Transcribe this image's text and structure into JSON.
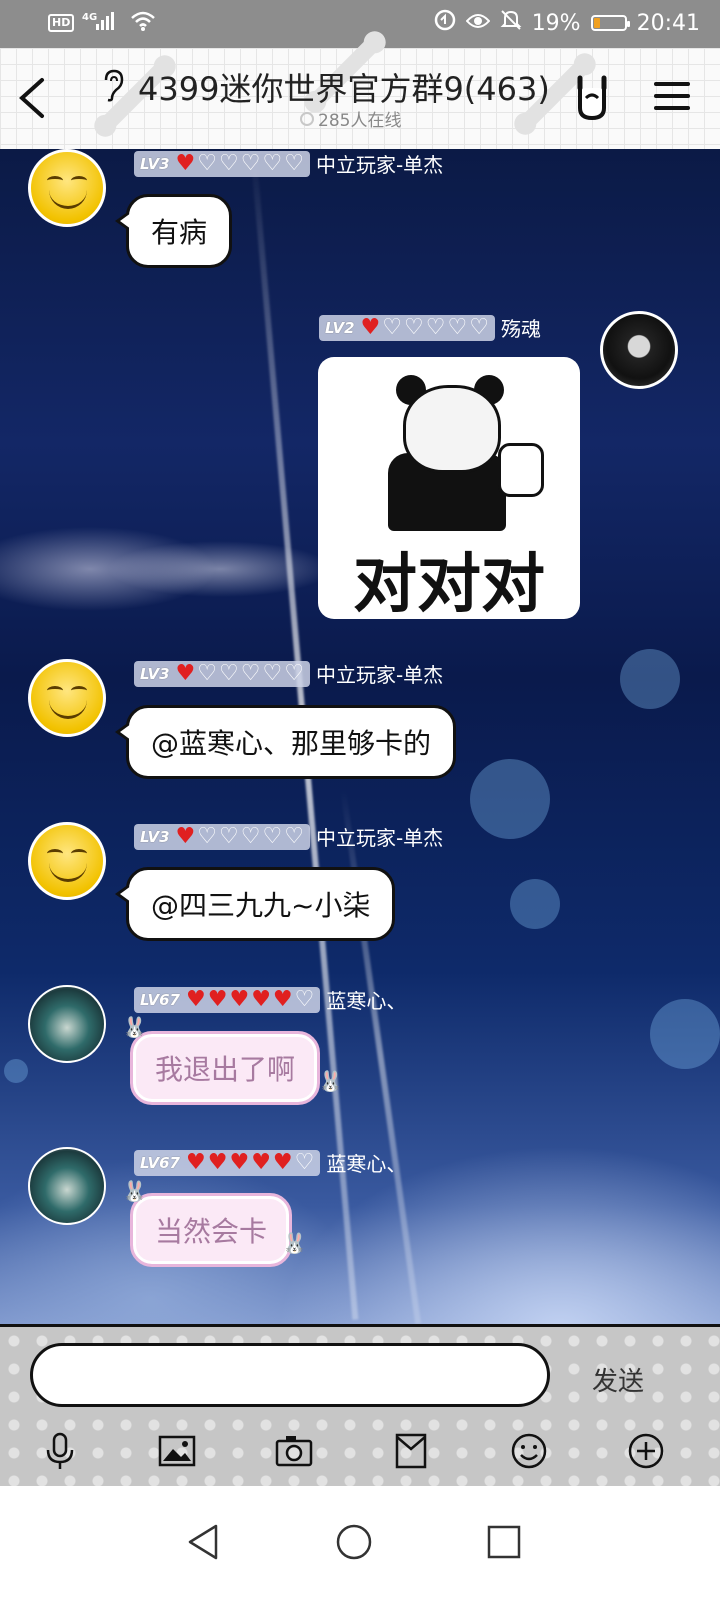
{
  "status_bar": {
    "network": "4G",
    "hd_label": "HD",
    "battery_percent": "19%",
    "battery_level": 0.19,
    "time": "20:41",
    "icons": [
      "hd-icon",
      "signal-icon",
      "wifi-icon",
      "data-saver-icon",
      "eye-icon",
      "mute-icon",
      "battery-icon"
    ]
  },
  "header": {
    "title": "4399迷你世界官方群9(463)",
    "online": "285人在线",
    "icons": [
      "back-icon",
      "ear-icon",
      "rock-hand-icon",
      "menu-icon"
    ]
  },
  "messages": [
    {
      "side": "left",
      "level": "LV3",
      "hearts_filled": 1,
      "hearts_total": 6,
      "nickname": "中立玩家-单杰",
      "type": "text",
      "text": "有病",
      "style": "white"
    },
    {
      "side": "right",
      "level": "LV2",
      "hearts_filled": 1,
      "hearts_total": 6,
      "nickname": "殇魂",
      "type": "sticker",
      "sticker_text": "对对对"
    },
    {
      "side": "left",
      "level": "LV3",
      "hearts_filled": 1,
      "hearts_total": 6,
      "nickname": "中立玩家-单杰",
      "type": "text",
      "text": "@蓝寒心、那里够卡的",
      "style": "white"
    },
    {
      "side": "left",
      "level": "LV3",
      "hearts_filled": 1,
      "hearts_total": 6,
      "nickname": "中立玩家-单杰",
      "type": "text",
      "text": "@四三九九~小柒",
      "style": "white"
    },
    {
      "side": "left",
      "level": "LV67",
      "hearts_filled": 5,
      "hearts_total": 6,
      "nickname": "蓝寒心、",
      "type": "text",
      "text": "我退出了啊",
      "style": "pink"
    },
    {
      "side": "left",
      "level": "LV67",
      "hearts_filled": 5,
      "hearts_total": 6,
      "nickname": "蓝寒心、",
      "type": "text",
      "text": "当然会卡",
      "style": "pink"
    }
  ],
  "input": {
    "value": "",
    "send_label": "发送",
    "tools": [
      "microphone-icon",
      "image-icon",
      "camera-icon",
      "envelope-icon",
      "emoji-icon",
      "plus-icon"
    ]
  },
  "nav_bar": {
    "buttons": [
      "back-triangle-icon",
      "home-circle-icon",
      "recents-square-icon"
    ]
  },
  "colors": {
    "heart_filled": "#e02020",
    "header_bg": "#fafafa",
    "status_bg": "#8d8d8d",
    "pink_bubble": "#fbe9f6"
  }
}
